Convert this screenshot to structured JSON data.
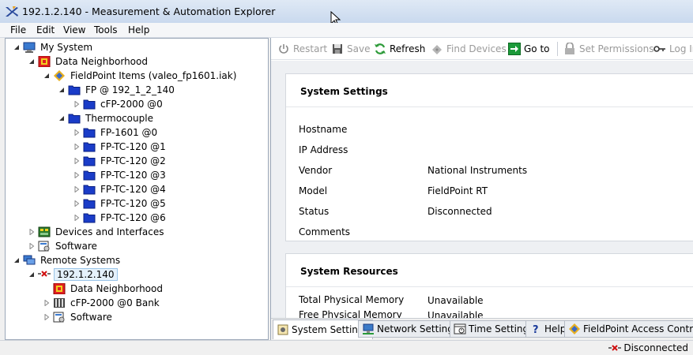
{
  "window": {
    "title": "192.1.2.140 - Measurement & Automation Explorer"
  },
  "menu": [
    {
      "label": "File"
    },
    {
      "label": "Edit"
    },
    {
      "label": "View"
    },
    {
      "label": "Tools"
    },
    {
      "label": "Help"
    }
  ],
  "tree": [
    {
      "label": "My System",
      "icon": "computer-icon",
      "indent": 0,
      "arrow": "expanded"
    },
    {
      "label": "Data Neighborhood",
      "icon": "data-neighborhood-icon",
      "indent": 1,
      "arrow": "expanded"
    },
    {
      "label": "FieldPoint Items (valeo_fp1601.iak)",
      "icon": "fieldpoint-icon",
      "indent": 2,
      "arrow": "expanded"
    },
    {
      "label": "FP @ 192_1_2_140",
      "icon": "folder-icon",
      "indent": 3,
      "arrow": "expanded"
    },
    {
      "label": "cFP-2000 @0",
      "icon": "folder-icon",
      "indent": 4,
      "arrow": "collapsed"
    },
    {
      "label": "Thermocouple",
      "icon": "folder-icon",
      "indent": 3,
      "arrow": "expanded"
    },
    {
      "label": "FP-1601 @0",
      "icon": "folder-icon",
      "indent": 4,
      "arrow": "collapsed"
    },
    {
      "label": "FP-TC-120 @1",
      "icon": "folder-icon",
      "indent": 4,
      "arrow": "collapsed"
    },
    {
      "label": "FP-TC-120 @2",
      "icon": "folder-icon",
      "indent": 4,
      "arrow": "collapsed"
    },
    {
      "label": "FP-TC-120 @3",
      "icon": "folder-icon",
      "indent": 4,
      "arrow": "collapsed"
    },
    {
      "label": "FP-TC-120 @4",
      "icon": "folder-icon",
      "indent": 4,
      "arrow": "collapsed"
    },
    {
      "label": "FP-TC-120 @5",
      "icon": "folder-icon",
      "indent": 4,
      "arrow": "collapsed"
    },
    {
      "label": "FP-TC-120 @6",
      "icon": "folder-icon",
      "indent": 4,
      "arrow": "collapsed"
    },
    {
      "label": "Devices and Interfaces",
      "icon": "devices-icon",
      "indent": 1,
      "arrow": "collapsed"
    },
    {
      "label": "Software",
      "icon": "software-icon",
      "indent": 1,
      "arrow": "collapsed"
    },
    {
      "label": "Remote Systems",
      "icon": "remote-systems-icon",
      "indent": 0,
      "arrow": "expanded"
    },
    {
      "label": "192.1.2.140",
      "icon": "disconnected-icon",
      "indent": 1,
      "arrow": "expanded",
      "selected": true
    },
    {
      "label": "Data Neighborhood",
      "icon": "data-neighborhood-icon",
      "indent": 2,
      "arrow": "none"
    },
    {
      "label": "cFP-2000 @0 Bank",
      "icon": "bank-icon",
      "indent": 2,
      "arrow": "collapsed"
    },
    {
      "label": "Software",
      "icon": "software-icon",
      "indent": 2,
      "arrow": "collapsed"
    }
  ],
  "toolbar": {
    "restart": "Restart",
    "save": "Save",
    "refresh": "Refresh",
    "find_devices": "Find Devices",
    "goto": "Go to",
    "set_permissions": "Set Permissions",
    "login": "Log In"
  },
  "system_settings": {
    "title": "System Settings",
    "fields": [
      {
        "label": "Hostname",
        "value": ""
      },
      {
        "label": "IP Address",
        "value": ""
      },
      {
        "label": "Vendor",
        "value": "National Instruments"
      },
      {
        "label": "Model",
        "value": "FieldPoint RT"
      },
      {
        "label": "Status",
        "value": "Disconnected"
      },
      {
        "label": "Comments",
        "value": ""
      }
    ]
  },
  "system_resources": {
    "title": "System Resources",
    "fields": [
      {
        "label": "Total Physical Memory",
        "value": "Unavailable"
      },
      {
        "label": "Free Physical Memory",
        "value": "Unavailable"
      }
    ]
  },
  "tabs": [
    {
      "label": "System Settings",
      "icon": "system-settings-icon",
      "active": true
    },
    {
      "label": "Network Settings",
      "icon": "network-icon"
    },
    {
      "label": "Time Settings",
      "icon": "time-icon"
    },
    {
      "label": "Help",
      "icon": "help-icon"
    },
    {
      "label": "FieldPoint Access Control",
      "icon": "fieldpoint-icon"
    }
  ],
  "status": {
    "text": "Disconnected"
  },
  "colors": {
    "folder": "#1a3cc8",
    "accent": "#99c4e8",
    "goto_green": "#1c9a3a",
    "refresh_green": "#2e9b3a",
    "disconnected_red": "#d01010"
  }
}
